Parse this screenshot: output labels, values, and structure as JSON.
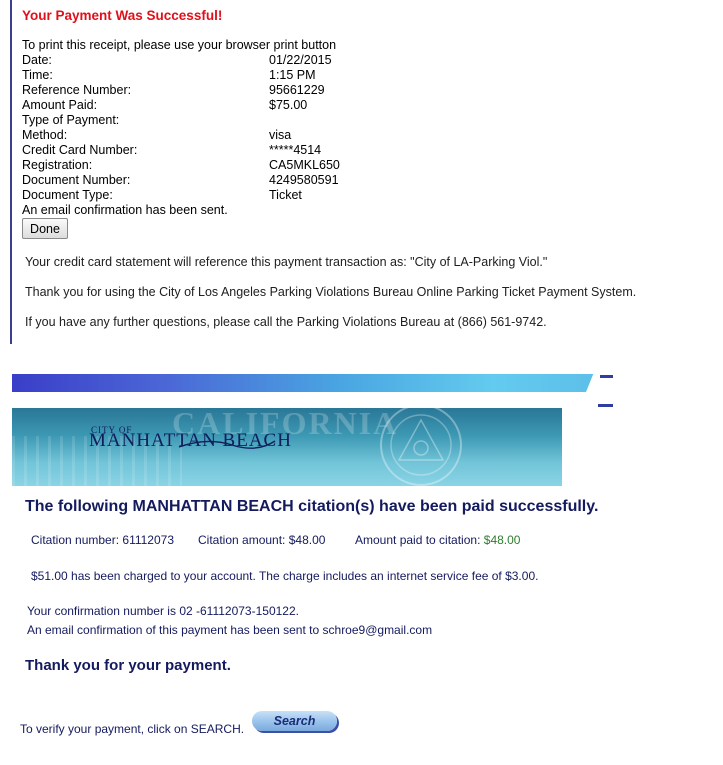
{
  "la_receipt": {
    "title": "Your Payment Was Successful!",
    "print_instruction": "To print this receipt, please use your browser print button",
    "fields": [
      {
        "label": "Date:",
        "value": "01/22/2015"
      },
      {
        "label": "Time:",
        "value": "1:15 PM"
      },
      {
        "label": "Reference Number:",
        "value": "95661229"
      },
      {
        "label": "Amount Paid:",
        "value": "$75.00"
      },
      {
        "label": "Type of Payment:",
        "value": ""
      },
      {
        "label": "Method:",
        "value": "visa"
      },
      {
        "label": "Credit Card Number:",
        "value": "*****4514"
      },
      {
        "label": "Registration:",
        "value": "CA5MKL650"
      },
      {
        "label": "Document Number:",
        "value": "4249580591"
      },
      {
        "label": "Document Type:",
        "value": "Ticket"
      }
    ],
    "email_sent": "An email confirmation has been sent.",
    "done_label": "Done",
    "statement_note": "Your credit card statement will reference this payment transaction as: \"City of LA-Parking Viol.\"",
    "thanks_note": "Thank you for using the City of Los Angeles Parking Violations Bureau Online Parking Ticket Payment System.",
    "questions_note": "If you have any further questions, please call the Parking Violations Bureau at (866) 561-9742."
  },
  "manhattan": {
    "banner": {
      "city_of": "CITY OF",
      "city_name": "MANHATTAN BEACH",
      "state_watermark": "CALIFORNIA",
      "seal_text": "CITY OF MANHATTAN BEACH"
    },
    "headline": "The following MANHATTAN BEACH citation(s) have been paid successfully.",
    "citation_number_label": "Citation number:",
    "citation_number": "61112073",
    "citation_amount_label": "Citation amount:",
    "citation_amount": "$48.00",
    "amount_paid_label": "Amount paid to citation:",
    "amount_paid": "$48.00",
    "charge_note": "$51.00 has been charged to your account. The charge includes an internet service fee of $3.00.",
    "confirmation_label": "Your confirmation number is",
    "confirmation_number": "02 -61112073-150122.",
    "email_note_prefix": "An email confirmation of this payment has been sent to",
    "email": "schroe9@gmail.com",
    "thank_you": "Thank you for your payment.",
    "verify_text": "To verify your payment, click on SEARCH.",
    "search_label": "Search",
    "colors": {
      "heading": "#141a5e",
      "paid_amount": "#2f7d2f",
      "success_title": "#e0101a"
    }
  }
}
